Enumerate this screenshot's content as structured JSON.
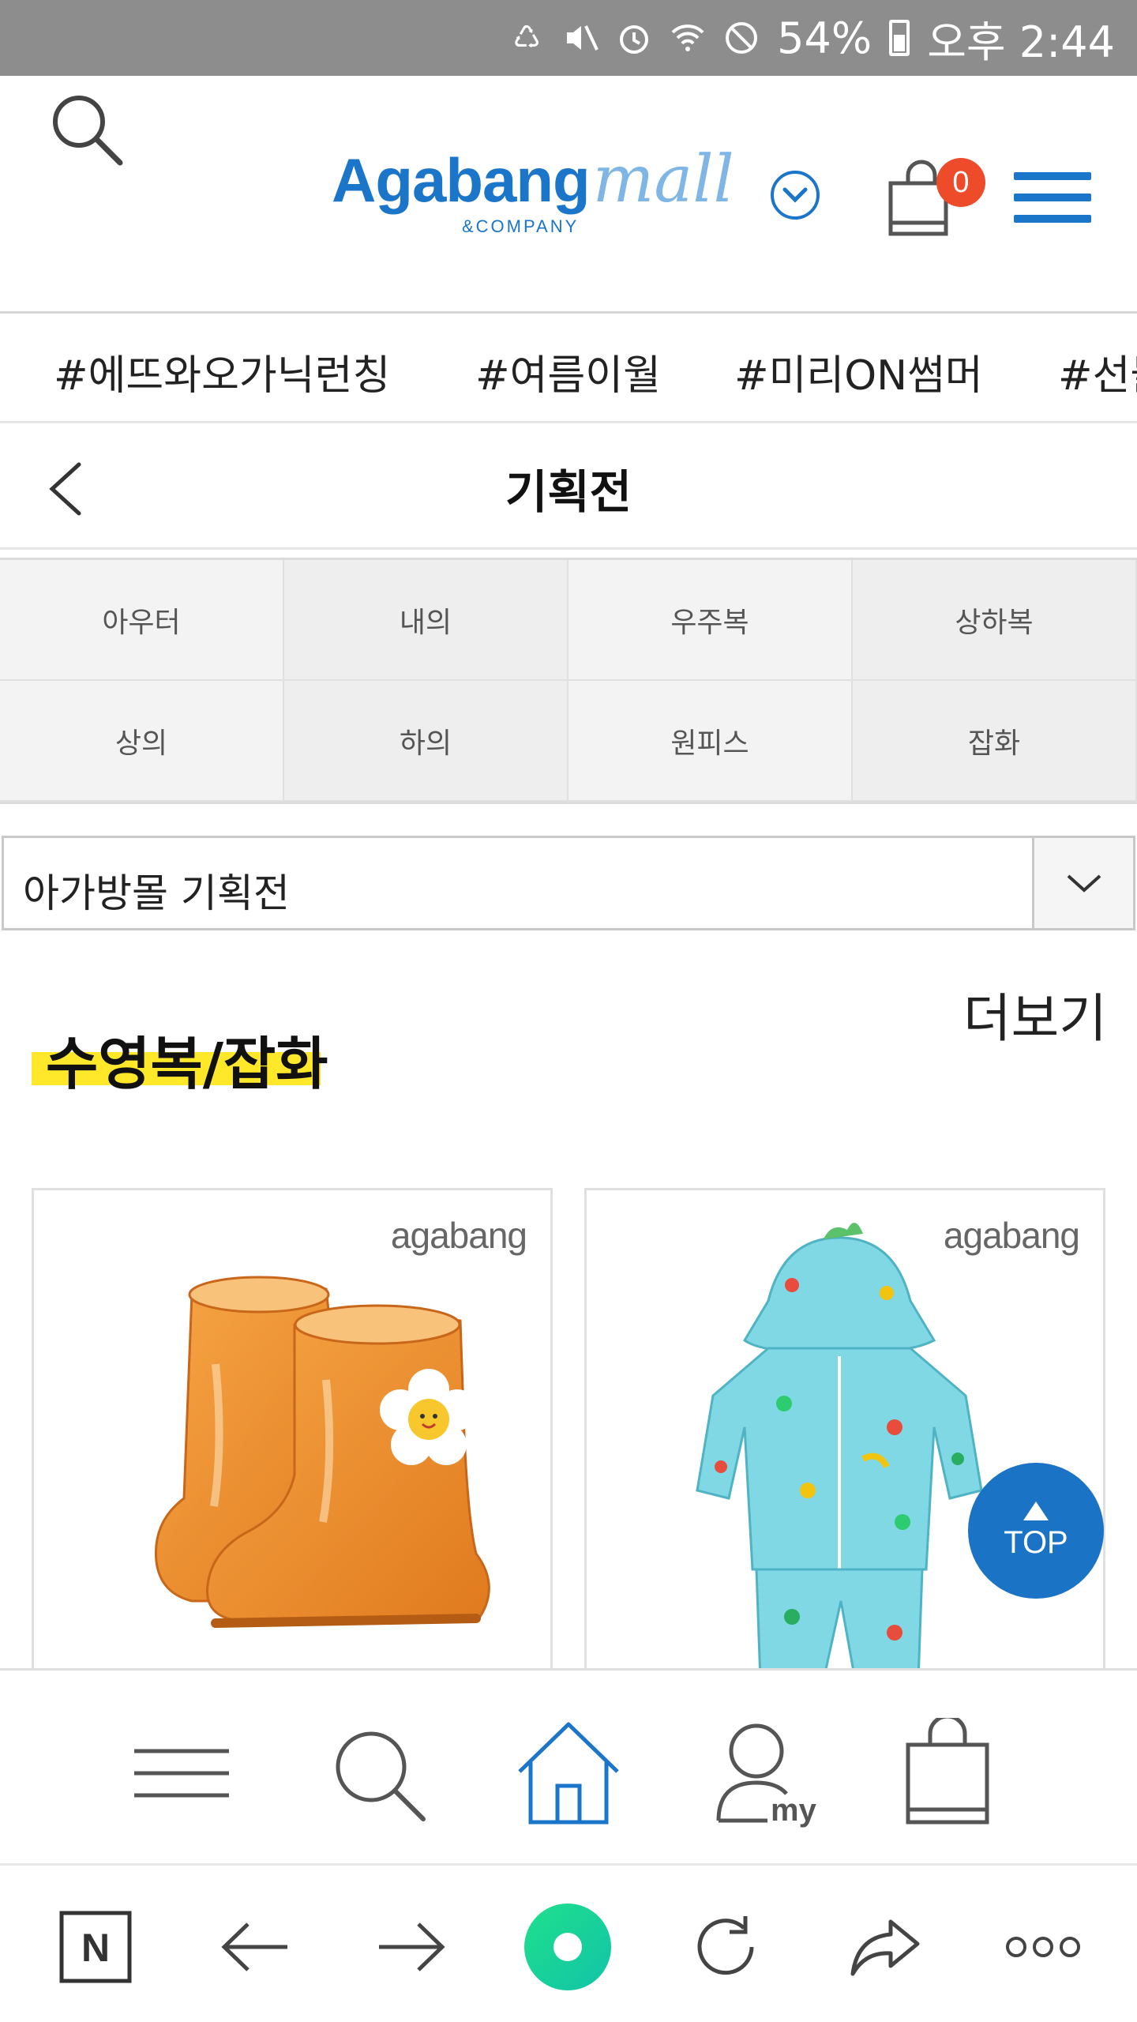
{
  "status_bar": {
    "battery_percent": "54%",
    "time": "오후 2:44",
    "icons": [
      "recycle-icon",
      "mute-icon",
      "alarm-icon",
      "wifi-icon",
      "blocked-icon",
      "battery-icon"
    ]
  },
  "header": {
    "logo_main": "Agabang",
    "logo_mall": "mall",
    "logo_sub": "&COMPANY",
    "cart_count": "0",
    "accent_color": "#1b75c9"
  },
  "hashtags": [
    "#에뜨와오가닉런칭",
    "#여름이월",
    "#미리ON썸머",
    "#선물"
  ],
  "page": {
    "title": "기획전"
  },
  "categories": [
    [
      "아우터",
      "내의",
      "우주복",
      "상하복"
    ],
    [
      "상의",
      "하의",
      "원피스",
      "잡화"
    ]
  ],
  "select": {
    "value": "아가방몰 기획전"
  },
  "section": {
    "title": "수영복/잡화",
    "more_label": "더보기",
    "highlight_color": "#ffe82a"
  },
  "products": [
    {
      "brand": "agabang",
      "image": "orange-rain-boots"
    },
    {
      "brand": "agabang",
      "image": "turquoise-swimsuit"
    }
  ],
  "top_button": {
    "label": "TOP"
  },
  "app_nav": [
    "menu-icon",
    "search-icon",
    "home-icon",
    "my-page-icon",
    "shopping-bag-icon"
  ],
  "browser_bar": [
    "naver-icon",
    "back-arrow-icon",
    "forward-arrow-icon",
    "green-dot-icon",
    "refresh-icon",
    "share-icon",
    "more-icon"
  ]
}
